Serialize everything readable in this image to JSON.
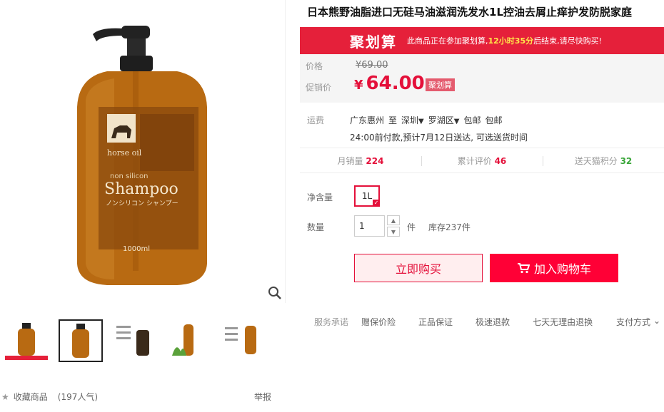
{
  "product": {
    "title": "日本熊野油脂进口无硅马油滋润洗发水1L控油去屑止痒护发防脱家庭"
  },
  "promo_banner": {
    "logo": "聚划算",
    "text_before": "此商品正在参加聚划算,",
    "highlight": "12小时35分",
    "text_after": "后结束,请尽快购买!"
  },
  "price": {
    "original_label": "价格",
    "original_value": "¥69.00",
    "promo_label": "促销价",
    "currency": "¥",
    "promo_value": "64.00",
    "promo_tag": "聚划算"
  },
  "shipping": {
    "label": "运费",
    "from": "广东惠州",
    "to_word": "至",
    "city": "深圳",
    "district": "罗湖区",
    "free1": "包邮",
    "free2": "包邮",
    "delivery_note": "24:00前付款,预计7月12日送达, 可选送货时间"
  },
  "stats": {
    "monthly_sales_label": "月销量",
    "monthly_sales": "224",
    "reviews_label": "累计评价",
    "reviews": "46",
    "points_label": "送天猫积分",
    "points": "32"
  },
  "spec": {
    "label": "净含量",
    "option": "1L"
  },
  "quantity": {
    "label": "数量",
    "value": "1",
    "unit": "件",
    "stock": "库存237件"
  },
  "buttons": {
    "buy_now": "立即购买",
    "add_cart": "加入购物车"
  },
  "services": {
    "label": "服务承诺",
    "items": [
      "赠保价险",
      "正品保证",
      "极速退款",
      "七天无理由退换"
    ],
    "payment": "支付方式"
  },
  "bottom": {
    "favorite": "收藏商品",
    "popularity": "(197人气)",
    "report": "举报"
  },
  "product_image_text": {
    "brand": "horse oil",
    "line1": "non silicon",
    "line2": "Shampoo",
    "line3": "ノンシリコン シャンプー",
    "volume": "1000ml"
  },
  "colors": {
    "accent_red": "#e4103a",
    "banner_red": "#e5203a",
    "bottle_amber": "#b86a12"
  }
}
